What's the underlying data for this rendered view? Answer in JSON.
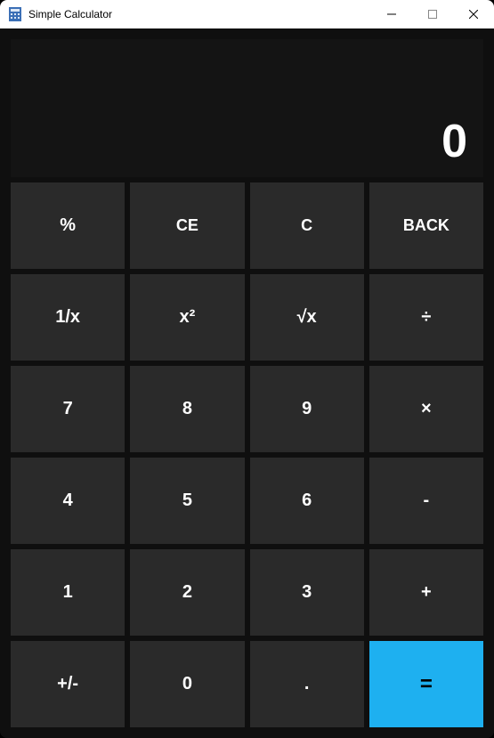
{
  "window": {
    "title": "Simple Calculator"
  },
  "display": {
    "value": "0"
  },
  "keys": {
    "percent": "%",
    "clear_entry": "CE",
    "clear": "C",
    "back": "BACK",
    "reciprocal": "1/x",
    "square": "x²",
    "sqrt": "√x",
    "divide": "÷",
    "n7": "7",
    "n8": "8",
    "n9": "9",
    "multiply": "×",
    "n4": "4",
    "n5": "5",
    "n6": "6",
    "subtract": "-",
    "n1": "1",
    "n2": "2",
    "n3": "3",
    "add": "+",
    "negate": "+/-",
    "n0": "0",
    "decimal": ".",
    "equals": "="
  },
  "colors": {
    "accent": "#1eb0f0",
    "key_bg": "#2a2a2a",
    "app_bg": "#0f0f0f"
  }
}
